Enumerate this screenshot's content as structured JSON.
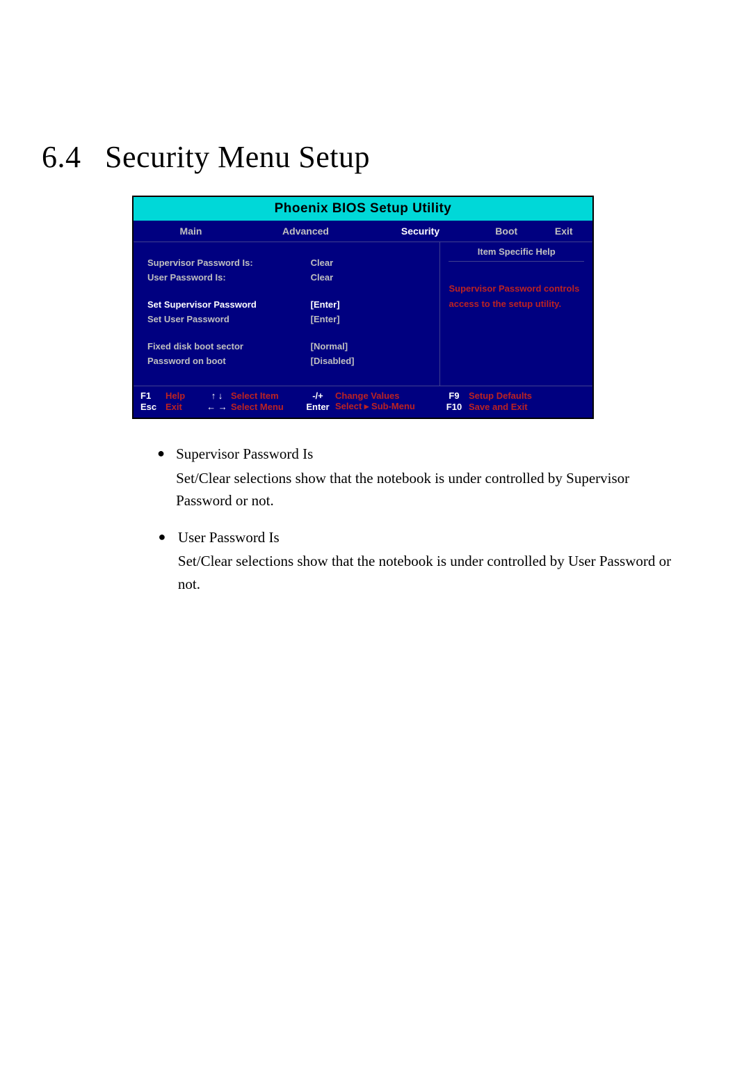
{
  "heading": "6.4   Security Menu Setup",
  "bios": {
    "title": "Phoenix BIOS Setup Utility",
    "tabs": {
      "main": "Main",
      "advanced": "Advanced",
      "security": "Security",
      "boot": "Boot",
      "exit": "Exit"
    },
    "help_title": "Item Specific Help",
    "help_body": "Supervisor Password controls access to the setup utility.",
    "rows": {
      "sup_is": {
        "label": "Supervisor Password Is:",
        "value": "Clear"
      },
      "user_is": {
        "label": "User Password Is:",
        "value": "Clear"
      },
      "set_sup": {
        "label": "Set Supervisor Password",
        "value": "[Enter]"
      },
      "set_user": {
        "label": "Set User Password",
        "value": "[Enter]"
      },
      "fixed_boot": {
        "label": "Fixed disk boot sector",
        "value": "[Normal]"
      },
      "pw_on_boot": {
        "label": "Password on boot",
        "value": "[Disabled]"
      }
    },
    "footer": {
      "f1": "F1",
      "help": "Help",
      "updn": "↑ ↓",
      "sel_item": "Select Item",
      "pm": "-/+",
      "chg_val": "Change Values",
      "f9": "F9",
      "defaults": "Setup Defaults",
      "esc": "Esc",
      "exit": "Exit",
      "lr": "← →",
      "sel_menu": "Select Menu",
      "enter": "Enter",
      "sub_menu": "Select ▸ Sub-Menu",
      "f10": "F10",
      "save": "Save and Exit"
    }
  },
  "notes": [
    {
      "title": "Supervisor Password Is",
      "body": "Set/Clear selections show that the notebook is under controlled by Supervisor Password or not."
    },
    {
      "title": "User Password Is",
      "body": "Set/Clear selections show that the notebook is under controlled by User Password or not."
    }
  ]
}
